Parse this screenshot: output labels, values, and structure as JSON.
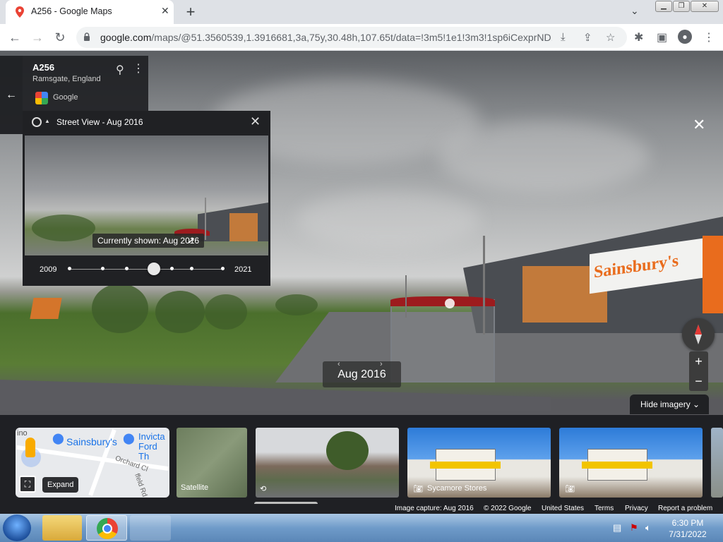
{
  "browser": {
    "tab_title": "A256 - Google Maps",
    "new_tab": "+",
    "tab_close": "✕",
    "url_host": "google.com",
    "url_path": "/maps/@51.3560539,1.3916681,3a,75y,30.48h,107.65t/data=!3m5!1e1!3m3!1sp6iCexprND..."
  },
  "place_card": {
    "title": "A256",
    "subtitle": "Ramsgate, England",
    "provider": "Google"
  },
  "time_machine": {
    "header": "Street View - Aug 2016",
    "tooltip": "Currently shown: Aug 2016",
    "start_year": "2009",
    "end_year": "2021",
    "selected_index": 3,
    "stops": 7
  },
  "date_badge": "Aug 2016",
  "storefront_sign": "Sainsbury's",
  "hide_imagery": "Hide imagery",
  "strip": {
    "map_labels": [
      "Sainsbury's",
      "Invicta Ford Th",
      "Orchard Cl",
      "ffeld Rd",
      "ino"
    ],
    "expand": "Expand",
    "satellite": "Satellite",
    "photo_1_label": "Sycamore Stores"
  },
  "footer": {
    "capture": "Image capture: Aug 2016",
    "copyright": "© 2022 Google",
    "country": "United States",
    "terms": "Terms",
    "privacy": "Privacy",
    "report": "Report a problem"
  },
  "taskbar": {
    "time": "6:30 PM",
    "date": "7/31/2022"
  },
  "colors": {
    "sainsbury_orange": "#e96c1d",
    "panel_dark": "#202124",
    "chrome_bg": "#dee1e6"
  }
}
